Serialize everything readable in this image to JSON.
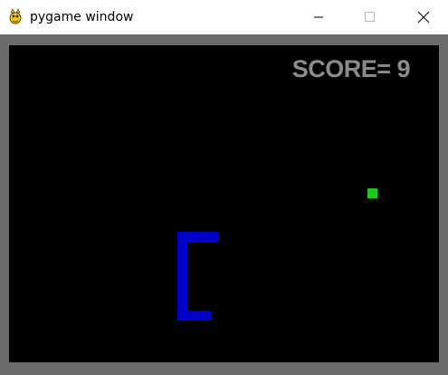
{
  "window": {
    "title": "pygame window",
    "app_icon": "pygame-snake-icon",
    "controls": {
      "minimize_icon": "minimize-icon",
      "maximize_icon": "maximize-icon",
      "close_icon": "close-icon"
    }
  },
  "game": {
    "score_text": "SCORE= 9",
    "score": 9,
    "colors": {
      "background": "#000000",
      "frame": "#6b6b6b",
      "score": "#8c8c8c",
      "food": "#1ec81e",
      "snake": "#0000c8"
    }
  }
}
